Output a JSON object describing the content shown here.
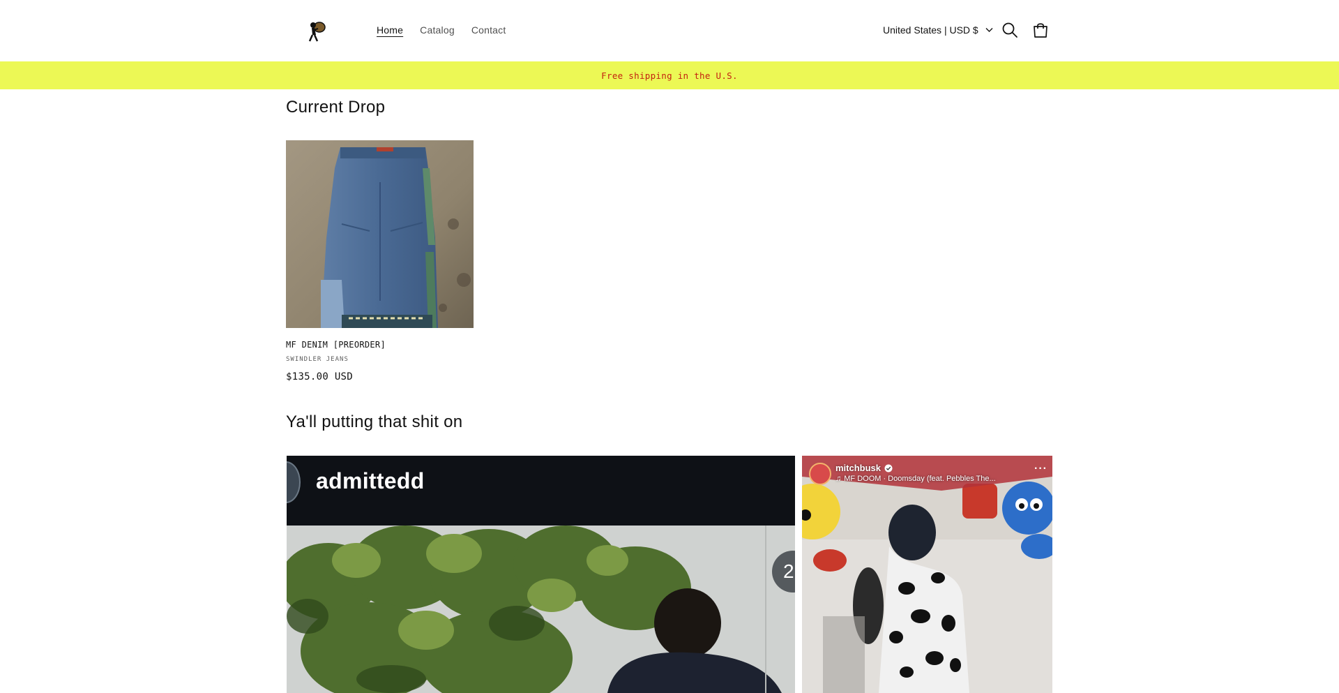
{
  "header": {
    "nav": [
      {
        "label": "Home",
        "active": true
      },
      {
        "label": "Catalog",
        "active": false
      },
      {
        "label": "Contact",
        "active": false
      }
    ],
    "country_selector": "United States | USD $",
    "icons": {
      "search": "search-icon",
      "cart": "cart-icon",
      "dropdown": "chevron-down-icon"
    }
  },
  "banner": {
    "text": "Free shipping in the U.S.",
    "bg_color": "#ecf855",
    "text_color": "#c4210f"
  },
  "current_drop": {
    "title": "Current Drop",
    "products": [
      {
        "name": "MF DENIM [PREORDER]",
        "vendor": "SWINDLER JEANS",
        "price": "$135.00 USD"
      }
    ]
  },
  "ugc": {
    "title": "Ya'll putting that shit on",
    "videos": [
      {
        "username": "admittedd",
        "badge": "2"
      },
      {
        "username": "mitchbusk",
        "song": "MF DOOM · Doomsday (feat. Pebbles The..."
      }
    ]
  }
}
